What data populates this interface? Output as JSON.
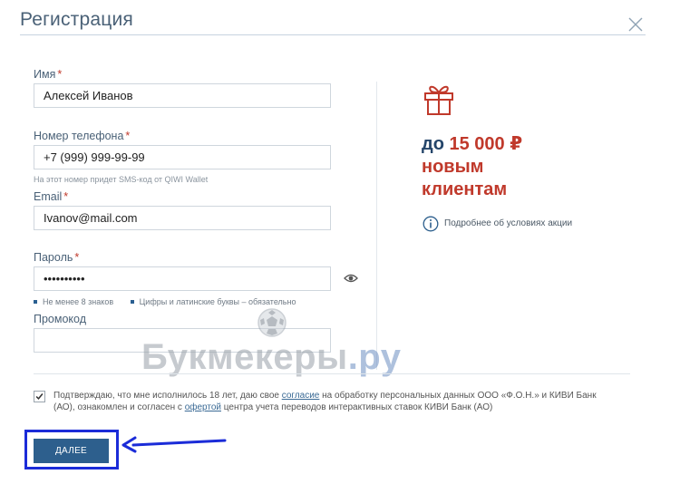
{
  "dialog": {
    "title": "Регистрация"
  },
  "form": {
    "name": {
      "label": "Имя",
      "required_mark": "*",
      "value": "Алексей Иванов"
    },
    "phone": {
      "label": "Номер телефона",
      "required_mark": "*",
      "value": "+7 (999) 999-99-99",
      "hint": "На этот номер придет SMS-код от QIWI Wallet"
    },
    "email": {
      "label": "Email",
      "required_mark": "*",
      "value": "Ivanov@mail.com"
    },
    "password": {
      "label": "Пароль",
      "required_mark": "*",
      "value": "••••••••••",
      "requirements": [
        "Не менее 8 знаков",
        "Цифры и латинские буквы – обязательно"
      ]
    },
    "promo": {
      "label": "Промокод",
      "value": ""
    },
    "consent": {
      "checked": true,
      "text_1": "Подтверждаю, что мне исполнилось 18 лет, даю свое ",
      "link_1": "согласие",
      "text_2": " на обработку персональных данных ООО «Ф.О.Н.» и КИВИ Банк (АО), ознакомлен и согласен с ",
      "link_2": "офертой",
      "text_3": " центра учета переводов интерактивных ставок КИВИ Банк (АО)"
    },
    "submit_label": "ДАЛЕЕ"
  },
  "promo_panel": {
    "line1_prefix": "до ",
    "amount": "15 000 ₽",
    "line2": "новым",
    "line3": "клиентам",
    "info_link": "Подробнее об условиях акции"
  },
  "watermark": {
    "text": "Букмекеры",
    "suffix": ".ру"
  },
  "colors": {
    "accent_blue": "#2d5f8d",
    "promo_red": "#c0392b",
    "annotation_blue": "#1b2cd8"
  }
}
